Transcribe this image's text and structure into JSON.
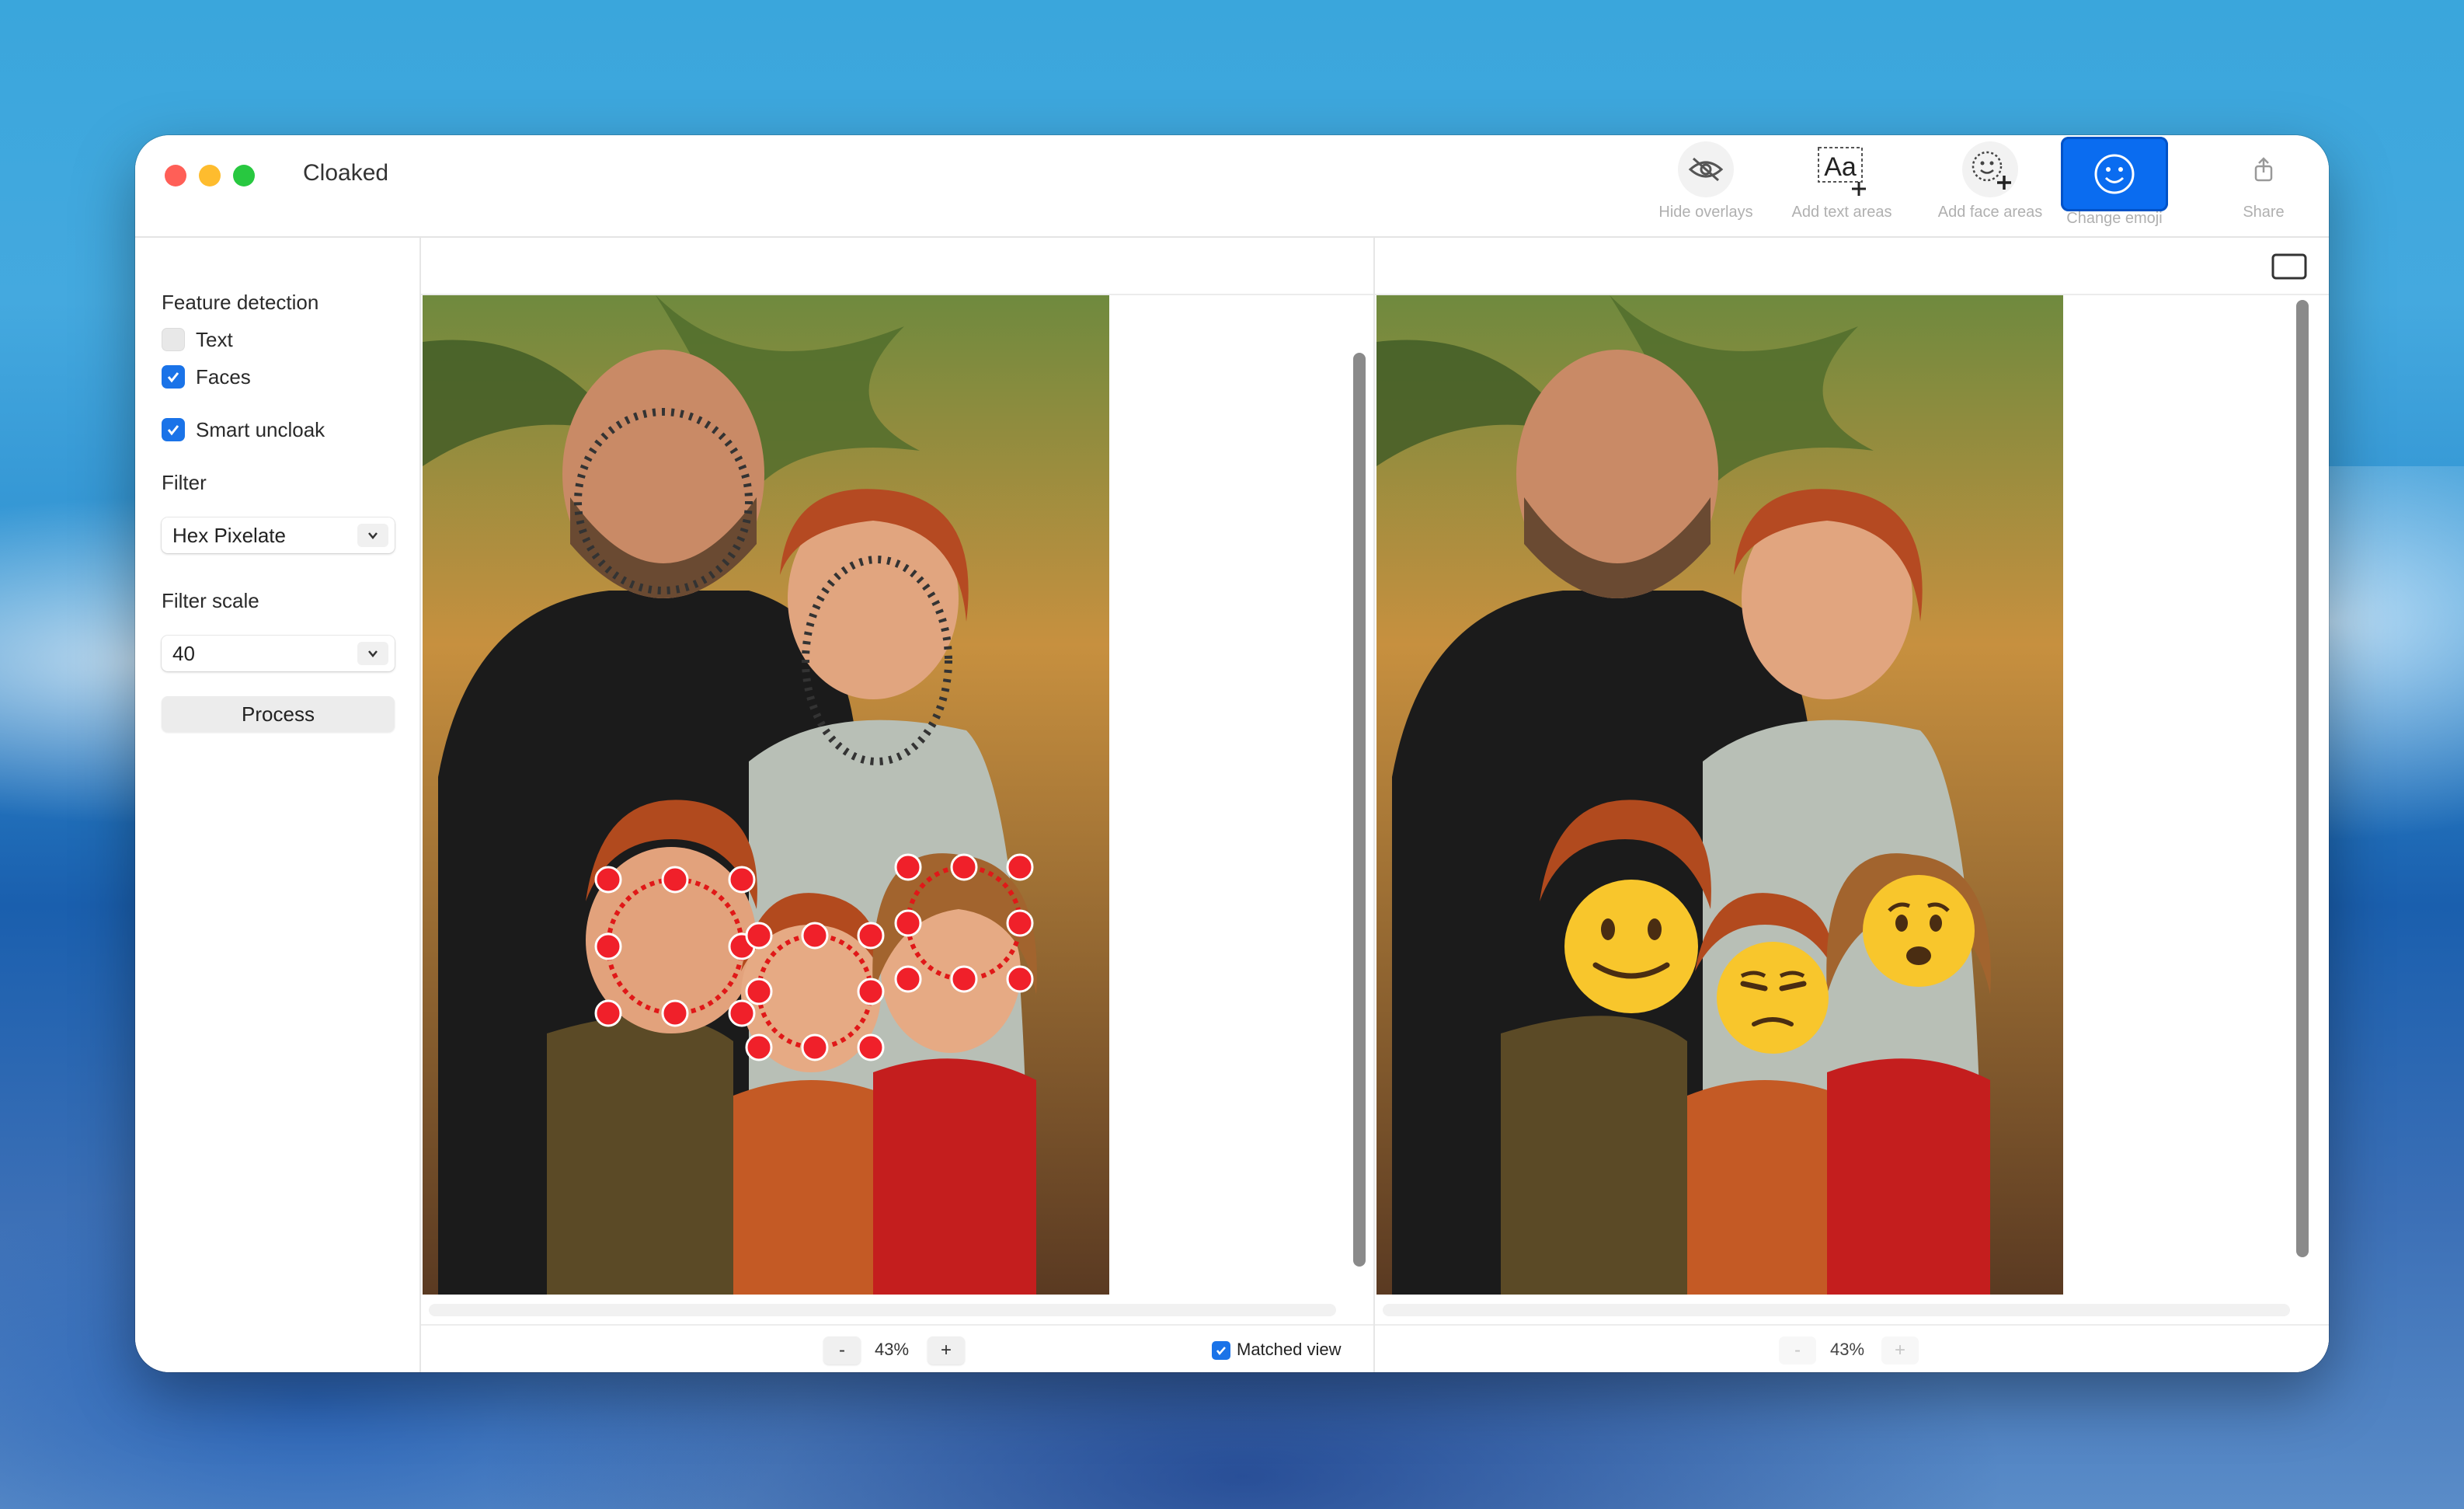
{
  "app": {
    "title": "Cloaked"
  },
  "toolbar": {
    "hide_overlays": "Hide overlays",
    "add_text_areas": "Add text areas",
    "add_text_icon_text": "Aa",
    "add_face_areas": "Add face areas",
    "change_emoji": "Change emoji",
    "share": "Share"
  },
  "sidebar": {
    "feature_detection": "Feature detection",
    "text_option": "Text",
    "text_checked": false,
    "faces_option": "Faces",
    "faces_checked": true,
    "smart_uncloak": "Smart uncloak",
    "smart_uncloak_checked": true,
    "filter_label": "Filter",
    "filter_value": "Hex Pixelate",
    "filter_scale_label": "Filter scale",
    "filter_scale_value": "40",
    "process_button": "Process"
  },
  "left_pane": {
    "zoom_out": "-",
    "zoom_level": "43%",
    "zoom_in": "+",
    "matched_view": "Matched view",
    "matched_view_checked": true
  },
  "right_pane": {
    "zoom_out": "-",
    "zoom_level": "43%",
    "zoom_in": "+"
  },
  "photo": {
    "left_overlays": {
      "face_detections": 2,
      "selected_face_areas": 3
    },
    "right_emojis": [
      "🙂",
      "😒",
      "😦"
    ]
  },
  "colors": {
    "accent": "#0a6cf0",
    "checkbox": "#1a73e8",
    "handle_red": "#f0202a"
  }
}
